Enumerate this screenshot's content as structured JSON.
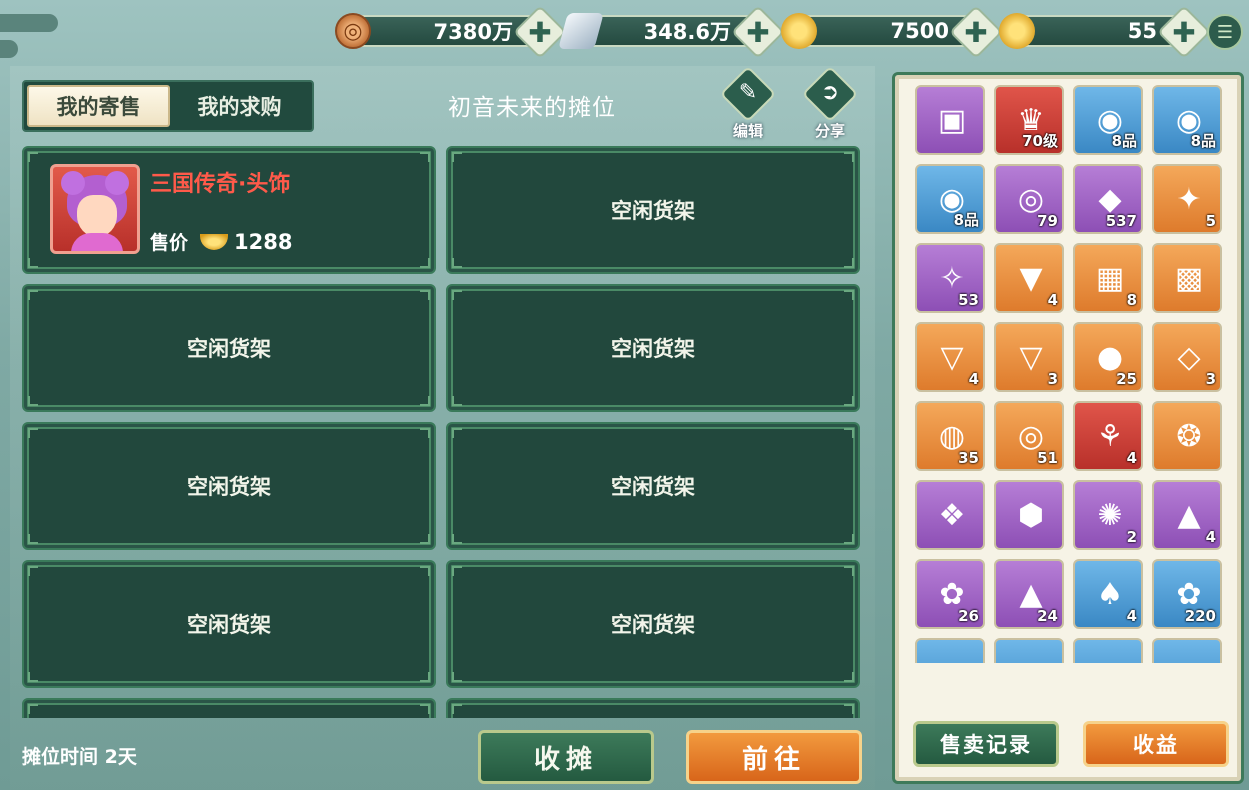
{
  "currency": [
    {
      "icon": "copper-coin-icon",
      "value": "7380万"
    },
    {
      "icon": "silver-ingot-icon",
      "value": "348.6万"
    },
    {
      "icon": "gold-ingot-bag-icon",
      "value": "7500"
    },
    {
      "icon": "gold-ingot-icon",
      "value": "55"
    }
  ],
  "tabs": [
    {
      "label": "我的寄售",
      "active": true
    },
    {
      "label": "我的求购",
      "active": false
    }
  ],
  "stall_title": "初音未来的摊位",
  "actions": {
    "edit_label": "编辑",
    "share_label": "分享"
  },
  "listed_item": {
    "name": "三国传奇·头饰",
    "price_label": "售价",
    "price": "1288"
  },
  "empty_slot_label": "空闲货架",
  "stall_time": "摊位时间 2天",
  "buttons": {
    "close_stall": "收摊",
    "go": "前往"
  },
  "bag": {
    "items": [
      {
        "bg": "purple",
        "glyph": "▣",
        "count": ""
      },
      {
        "bg": "red",
        "glyph": "♛",
        "count": "70级"
      },
      {
        "bg": "blue",
        "glyph": "◉",
        "count": "8品"
      },
      {
        "bg": "blue",
        "glyph": "◉",
        "count": "8品"
      },
      {
        "bg": "blue",
        "glyph": "◉",
        "count": "8品"
      },
      {
        "bg": "purple",
        "glyph": "◎",
        "count": "79"
      },
      {
        "bg": "purple",
        "glyph": "◆",
        "count": "537"
      },
      {
        "bg": "orange",
        "glyph": "✦",
        "count": "5"
      },
      {
        "bg": "purple",
        "glyph": "✧",
        "count": "53"
      },
      {
        "bg": "orange",
        "glyph": "▼",
        "count": "4"
      },
      {
        "bg": "orange",
        "glyph": "▦",
        "count": "8"
      },
      {
        "bg": "orange",
        "glyph": "▩",
        "count": ""
      },
      {
        "bg": "orange",
        "glyph": "▽",
        "count": "4"
      },
      {
        "bg": "orange",
        "glyph": "▽",
        "count": "3"
      },
      {
        "bg": "orange",
        "glyph": "●",
        "count": "25"
      },
      {
        "bg": "orange",
        "glyph": "◇",
        "count": "3"
      },
      {
        "bg": "orange",
        "glyph": "◍",
        "count": "35"
      },
      {
        "bg": "orange",
        "glyph": "◎",
        "count": "51"
      },
      {
        "bg": "red",
        "glyph": "⚘",
        "count": "4"
      },
      {
        "bg": "orange",
        "glyph": "❂",
        "count": ""
      },
      {
        "bg": "purple",
        "glyph": "❖",
        "count": ""
      },
      {
        "bg": "purple",
        "glyph": "⬢",
        "count": ""
      },
      {
        "bg": "purple",
        "glyph": "✺",
        "count": "2"
      },
      {
        "bg": "purple",
        "glyph": "▲",
        "count": "4"
      },
      {
        "bg": "purple",
        "glyph": "✿",
        "count": "26"
      },
      {
        "bg": "purple",
        "glyph": "▲",
        "count": "24"
      },
      {
        "bg": "blue",
        "glyph": "♠",
        "count": "4"
      },
      {
        "bg": "blue",
        "glyph": "✿",
        "count": "220"
      },
      {
        "bg": "blue",
        "glyph": "",
        "count": ""
      },
      {
        "bg": "blue",
        "glyph": "",
        "count": ""
      },
      {
        "bg": "blue",
        "glyph": "",
        "count": ""
      },
      {
        "bg": "blue",
        "glyph": "",
        "count": ""
      }
    ],
    "sale_record_label": "售卖记录",
    "income_label": "收益"
  }
}
